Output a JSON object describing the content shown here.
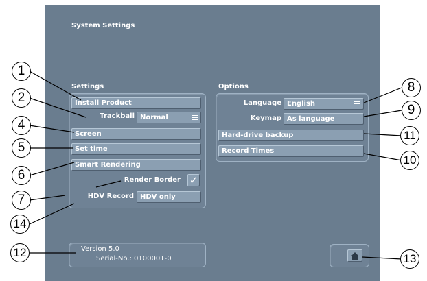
{
  "window": {
    "title": "System Settings"
  },
  "settings": {
    "section_label": "Settings",
    "install_product": "Install Product",
    "trackball_label": "Trackball",
    "trackball_value": "Normal",
    "screen": "Screen",
    "set_time": "Set time",
    "smart_rendering": "Smart Rendering",
    "render_border_label": "Render Border",
    "render_border_checked": true,
    "render_border_mark": "✓",
    "hdv_record_label": "HDV Record",
    "hdv_record_value": "HDV only"
  },
  "options": {
    "section_label": "Options",
    "language_label": "Language",
    "language_value": "English",
    "keymap_label": "Keymap",
    "keymap_value": "As language",
    "hard_drive_backup": "Hard-drive backup",
    "record_times": "Record Times"
  },
  "version": {
    "version_text": "Version 5.0",
    "serial_text": "Serial-No.: 0100001-0"
  },
  "home_button": {
    "icon": "home-icon"
  },
  "callouts": [
    "1",
    "2",
    "4",
    "5",
    "6",
    "7",
    "14",
    "12",
    "8",
    "9",
    "11",
    "10",
    "13"
  ],
  "colors": {
    "background": "#6a7d8f",
    "button": "#8b9fb2",
    "text": "#ffffff"
  }
}
